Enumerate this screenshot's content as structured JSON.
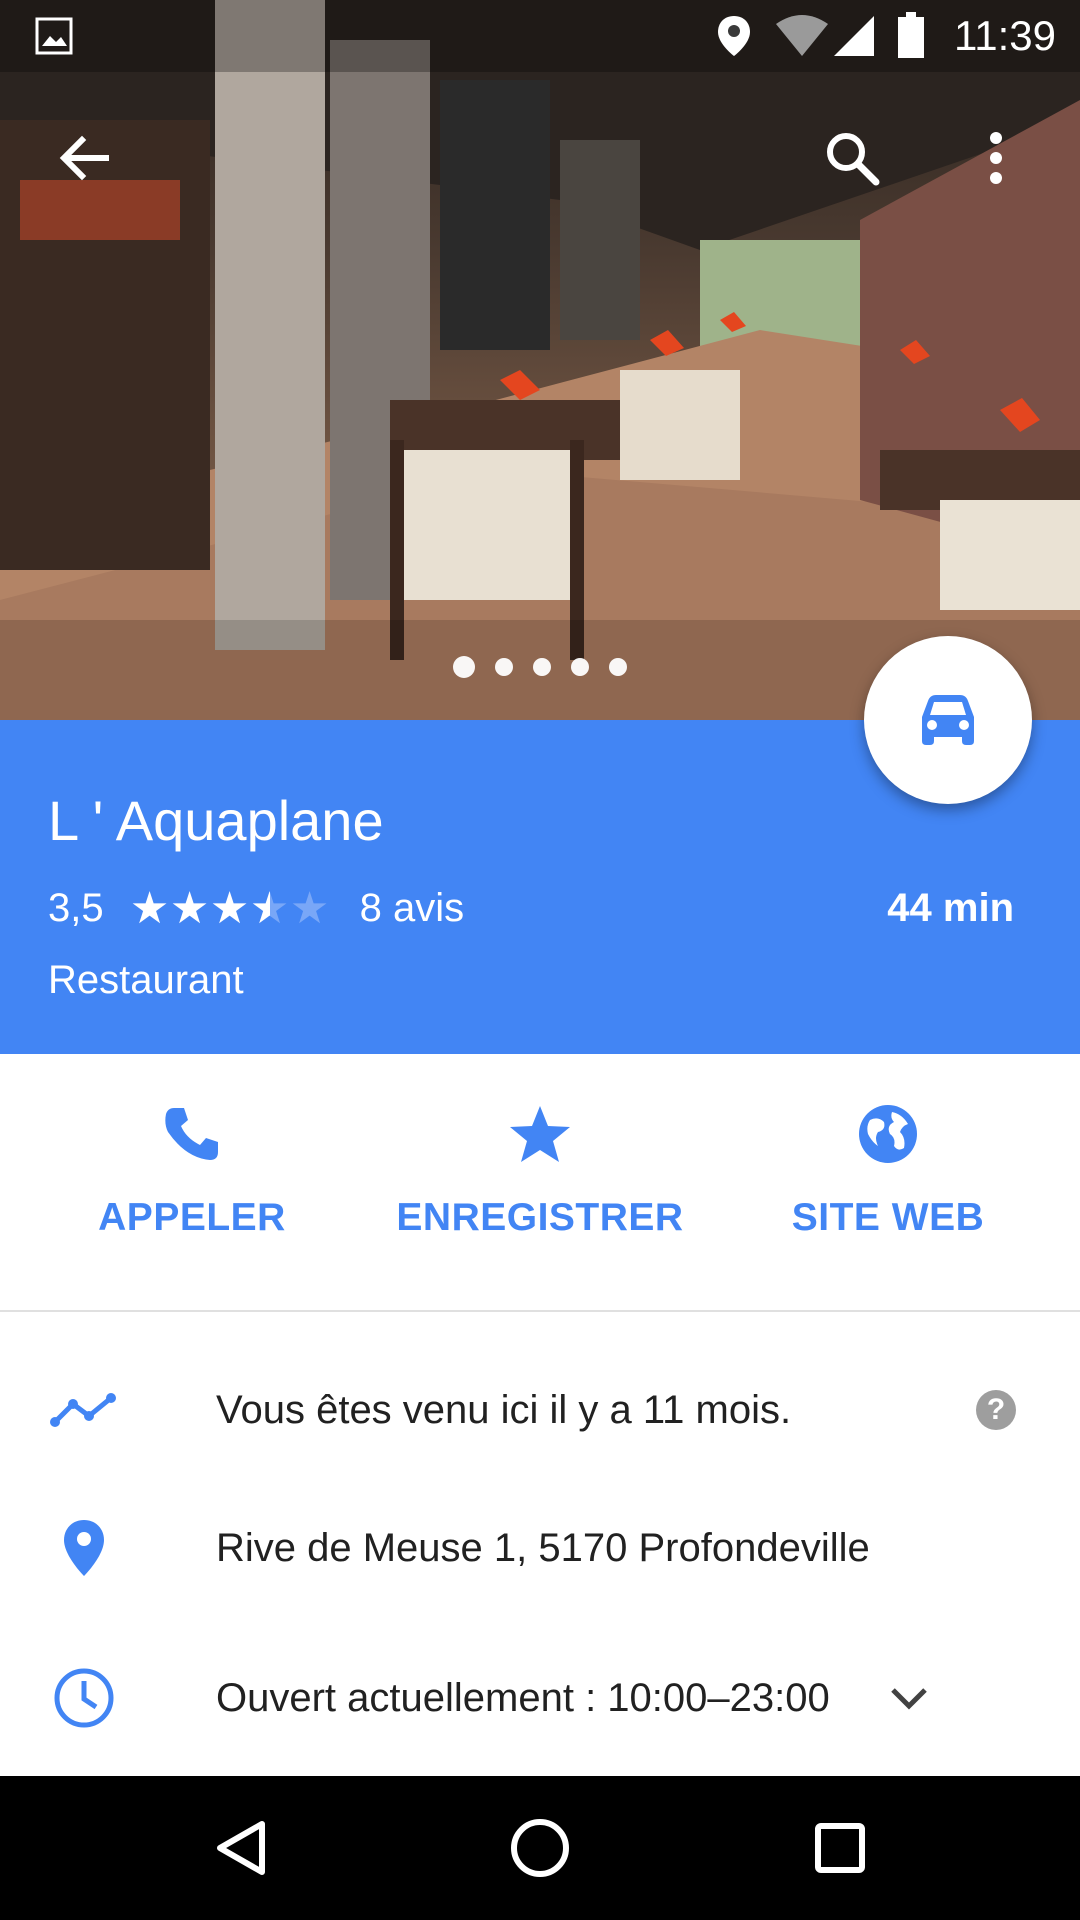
{
  "status_bar": {
    "time": "11:39"
  },
  "photo": {
    "description_icon": "restaurant-photo",
    "pages": 5,
    "active_page": 0
  },
  "place": {
    "name": "L ' Aquaplane",
    "rating": "3,5",
    "rating_value": 3.5,
    "reviews": "8 avis",
    "category": "Restaurant",
    "travel_time": "44 min"
  },
  "actions": [
    {
      "label": "APPELER",
      "icon": "phone-icon"
    },
    {
      "label": "ENREGISTRER",
      "icon": "star-icon"
    },
    {
      "label": "SITE WEB",
      "icon": "globe-icon"
    }
  ],
  "info": {
    "visit": "Vous êtes venu ici il y a 11 mois.",
    "address": "Rive de Meuse 1, 5170 Profondeville",
    "hours": "Ouvert actuellement : 10:00–23:00"
  },
  "colors": {
    "accent": "#4285f4",
    "navbar": "#000000"
  }
}
